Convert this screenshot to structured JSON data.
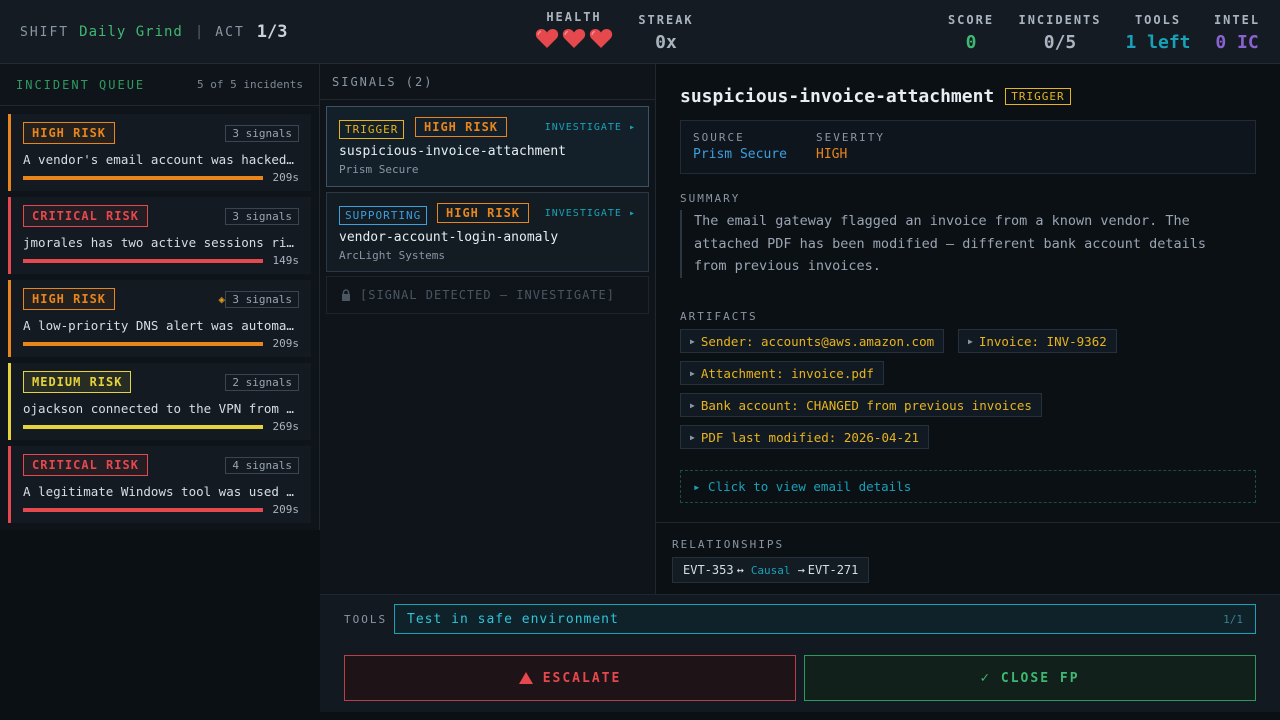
{
  "header": {
    "shift_label": "SHIFT",
    "shift_name": "Daily Grind",
    "separator": "|",
    "act_label": "ACT",
    "act_value": "1/3",
    "health_label": "HEALTH",
    "health_hearts": 3,
    "streak_label": "STREAK",
    "streak_value": "0x",
    "score_label": "SCORE",
    "score_value": "0",
    "incidents_label": "INCIDENTS",
    "incidents_value": "0/5",
    "tools_label": "TOOLS",
    "tools_value": "1 left",
    "intel_label": "INTEL",
    "intel_value": "0 IC"
  },
  "queue": {
    "title": "INCIDENT QUEUE",
    "count": "5 of 5 incidents",
    "cards": [
      {
        "risk": "HIGH RISK",
        "signals": "3 signals",
        "desc": "A vendor's email account was hacked and used to send a fake invoice.",
        "time": "209s",
        "progress": 1.0,
        "color": "#e8851c",
        "flag": false
      },
      {
        "risk": "CRITICAL RISK",
        "signals": "3 signals",
        "desc": "jmorales has two active sessions right now from different countries.",
        "time": "149s",
        "progress": 1.0,
        "color": "#e5484d",
        "flag": false
      },
      {
        "risk": "HIGH RISK",
        "signals": "3 signals",
        "desc": "A low-priority DNS alert was automatically closed by the system.",
        "time": "209s",
        "progress": 1.0,
        "color": "#e8851c",
        "flag": true,
        "flag_icon": "◈"
      },
      {
        "risk": "MEDIUM RISK",
        "signals": "2 signals",
        "desc": "ojackson connected to the VPN from an unusual location.",
        "time": "269s",
        "progress": 1.0,
        "color": "#e6d33c",
        "flag": false
      },
      {
        "risk": "CRITICAL RISK",
        "signals": "4 signals",
        "desc": "A legitimate Windows tool was used to download a suspicious file.",
        "time": "209s",
        "progress": 1.0,
        "color": "#e5484d",
        "flag": false
      }
    ]
  },
  "signals": {
    "title": "SIGNALS (2)",
    "items": [
      {
        "tag": "TRIGGER",
        "tag_color": "#e8b41c",
        "risk": "HIGH RISK",
        "investigate": "INVESTIGATE ▸",
        "name": "suspicious-invoice-attachment",
        "source": "Prism Secure"
      },
      {
        "tag": "SUPPORTING",
        "tag_color": "#3b9fe0",
        "risk": "HIGH RISK",
        "investigate": "INVESTIGATE ▸",
        "name": "vendor-account-login-anomaly",
        "source": "ArcLight Systems"
      }
    ],
    "locked_text": "[SIGNAL DETECTED — INVESTIGATE]"
  },
  "detail": {
    "title": "suspicious-invoice-attachment",
    "tag": "TRIGGER",
    "source_label": "SOURCE",
    "source_value": "Prism Secure",
    "severity_label": "SEVERITY",
    "severity_value": "HIGH",
    "summary_label": "SUMMARY",
    "summary": "The email gateway flagged an invoice from a known vendor. The attached PDF has been modified — different bank account details from previous invoices.",
    "artifacts_label": "ARTIFACTS",
    "artifacts": [
      "Sender: accounts@aws.amazon.com",
      "Invoice: INV-9362",
      "Attachment: invoice.pdf",
      "Bank account: CHANGED from previous invoices",
      "PDF last modified: 2026-04-21"
    ],
    "email_button": "▸ Click to view email details",
    "relationships_label": "RELATIONSHIPS",
    "relationship": {
      "from": "EVT-353",
      "type": "Causal",
      "to": "EVT-271"
    }
  },
  "tools": {
    "label": "TOOLS",
    "tool_name": "Test in safe environment",
    "tool_count": "1/1"
  },
  "actions": {
    "escalate": "ESCALATE",
    "close": "CLOSE FP"
  },
  "colors": {
    "green": "#3fb872",
    "cyan": "#17a2b8",
    "purple": "#8a63d2",
    "orange": "#e8851c",
    "red": "#e5484d",
    "yellow": "#e6d33c",
    "amber": "#e8b41c"
  }
}
